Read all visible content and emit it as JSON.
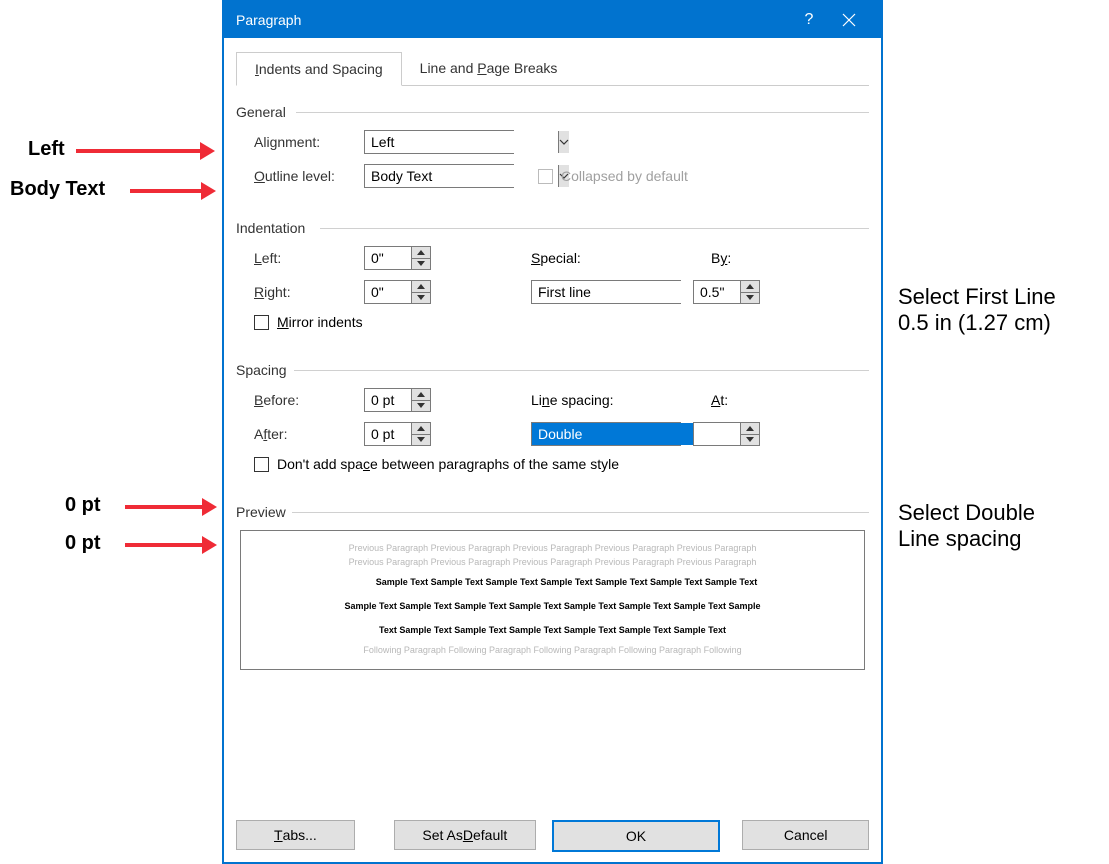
{
  "titlebar": {
    "title": "Paragraph"
  },
  "tabs": {
    "indents_spacing": "Indents and Spacing",
    "line_page_breaks": "Line and Page Breaks"
  },
  "general": {
    "heading": "General",
    "alignment_label": "Alignment:",
    "alignment_value": "Left",
    "outline_label": "Outline level:",
    "outline_value": "Body Text",
    "collapsed_label": "Collapsed by default"
  },
  "indentation": {
    "heading": "Indentation",
    "left_label": "Left:",
    "left_value": "0\"",
    "right_label": "Right:",
    "right_value": "0\"",
    "special_label": "Special:",
    "special_value": "First line",
    "by_label": "By:",
    "by_value": "0.5\"",
    "mirror_label": "Mirror indents"
  },
  "spacing": {
    "heading": "Spacing",
    "before_label": "Before:",
    "before_value": "0 pt",
    "after_label": "After:",
    "after_value": "0 pt",
    "linespacing_label": "Line spacing:",
    "linespacing_value": "Double",
    "at_label": "At:",
    "at_value": "",
    "dontadd_label": "Don't add space between paragraphs of the same style"
  },
  "preview": {
    "heading": "Preview",
    "prev_para": "Previous Paragraph Previous Paragraph Previous Paragraph Previous Paragraph Previous Paragraph",
    "prev_para2": "Previous Paragraph Previous Paragraph Previous Paragraph Previous Paragraph Previous Paragraph",
    "sample1": "Sample Text Sample Text Sample Text Sample Text Sample Text Sample Text Sample Text",
    "sample2": "Sample Text Sample Text Sample Text Sample Text Sample Text Sample Text Sample Text Sample",
    "sample3": "Text Sample Text Sample Text Sample Text Sample Text Sample Text Sample Text",
    "following": "Following Paragraph Following Paragraph Following Paragraph Following Paragraph Following"
  },
  "buttons": {
    "tabs": "Tabs...",
    "set_default": "Set As Default",
    "ok": "OK",
    "cancel": "Cancel"
  },
  "annotations": {
    "left": "Left",
    "body_text": "Body Text",
    "opt_before": "0 pt",
    "opt_after": "0 pt",
    "first_line_l1": "Select First Line",
    "first_line_l2": "0.5 in (1.27 cm)",
    "double_l1": "Select Double",
    "double_l2": "Line spacing"
  }
}
